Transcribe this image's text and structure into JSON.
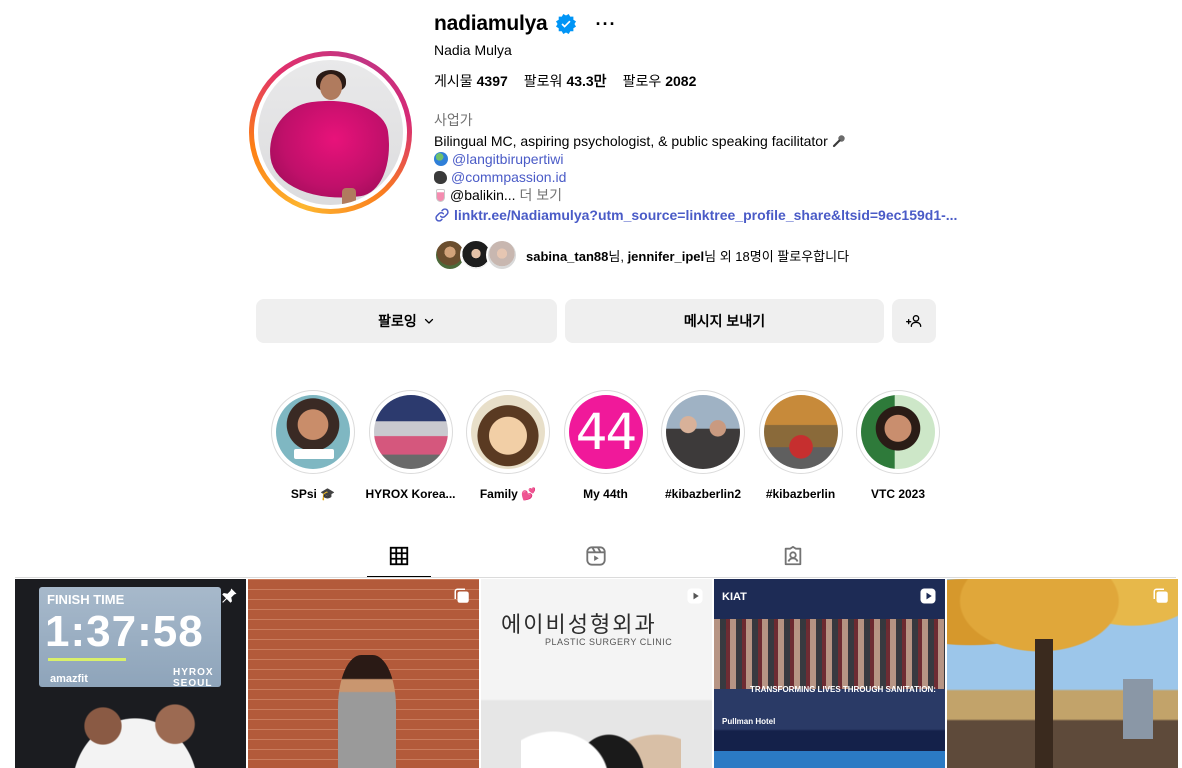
{
  "profile": {
    "username": "nadiamulya",
    "more_label": "···",
    "full_name": "Nadia Mulya",
    "stats": [
      {
        "label": "게시물",
        "value": "4397"
      },
      {
        "label": "팔로워",
        "value": "43.3만"
      },
      {
        "label": "팔로우",
        "value": "2082"
      }
    ],
    "category": "사업가",
    "bio_line1": "Bilingual MC, aspiring psychologist, & public speaking facilitator",
    "bio_mention1": "@langitbirupertiwi",
    "bio_mention2": "@commpassion.id",
    "bio_line4": "@balikin...",
    "bio_more": " 더 보기",
    "link": "linktr.ee/Nadiamulya?utm_source=linktree_profile_share&ltsid=9ec159d1-...",
    "followed_by_user1": "sabina_tan88",
    "followed_by_mid1": "님, ",
    "followed_by_user2": "jennifer_ipel",
    "followed_by_mid2": "님 외 18명이 팔로우합니다"
  },
  "buttons": {
    "following": "팔로잉",
    "message": "메시지 보내기"
  },
  "highlights": [
    {
      "label": "SPsi 🎓"
    },
    {
      "label": "HYROX Korea..."
    },
    {
      "label": "Family 💕"
    },
    {
      "label": "My 44th",
      "image_text": "44"
    },
    {
      "label": "#kibazberlin2"
    },
    {
      "label": "#kibazberlin"
    },
    {
      "label": "VTC 2023"
    }
  ],
  "posts": {
    "p1": {
      "finish": "FINISH TIME",
      "time": "1:37:58",
      "brand": "amazfit",
      "hyrox": "HYROX SEOUL"
    },
    "p3": {
      "sign": "에이비성형외과",
      "sub": "PLASTIC SURGERY CLINIC"
    },
    "p4": {
      "kiat": "KIAT",
      "headline": "TRANSFORMING LIVES THROUGH SANITATION:",
      "venue": "Pullman Hotel"
    }
  },
  "colors": {
    "link": "#4a5bc7",
    "button_bg": "#efefef",
    "verified": "#0095f6",
    "secondary_text": "#737373"
  },
  "icons": {
    "verified": "verified-badge-icon",
    "link": "link-icon",
    "chevron": "chevron-down-icon",
    "add_person": "add-person-icon",
    "grid_tab": "grid-icon",
    "reels_tab": "reels-icon",
    "tagged_tab": "tagged-icon",
    "pin": "pin-icon",
    "carousel": "carousel-icon",
    "video": "video-icon"
  }
}
